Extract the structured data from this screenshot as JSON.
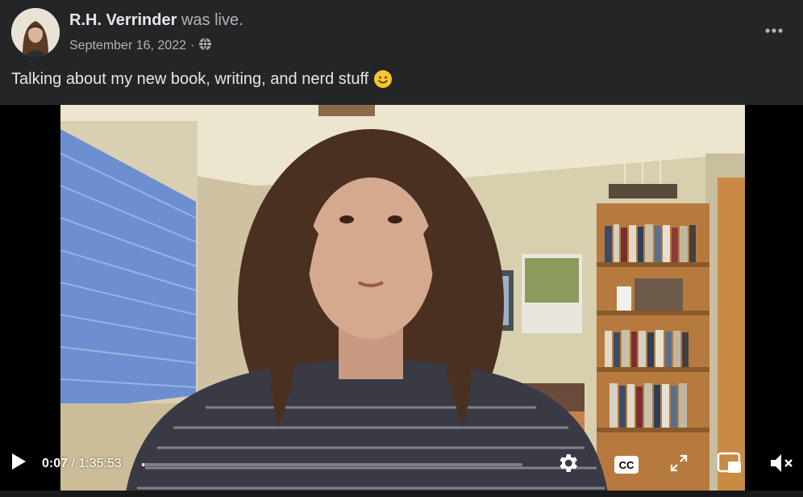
{
  "post": {
    "author_name": "R.H. Verrinder",
    "author_action": "was live.",
    "date": "September 16, 2022",
    "separator": "·",
    "privacy_icon": "globe-icon",
    "text": "Talking about my new book, writing, and nerd stuff",
    "emoji": "slightly-smiling-face",
    "more_icon": "ellipsis-icon"
  },
  "video": {
    "current_time": "0:07",
    "time_separator": "/",
    "duration": "1:35:53",
    "progress": 0.001,
    "icons": [
      "play-icon",
      "settings-gear-icon",
      "closed-captions-icon",
      "fullscreen-icon",
      "picture-in-picture-icon",
      "volume-muted-icon"
    ],
    "cc_label": "CC"
  },
  "colors": {
    "background": "#242526",
    "text_primary": "#e4e6eb",
    "text_secondary": "#b0b3b8",
    "video_background": "#000000"
  }
}
